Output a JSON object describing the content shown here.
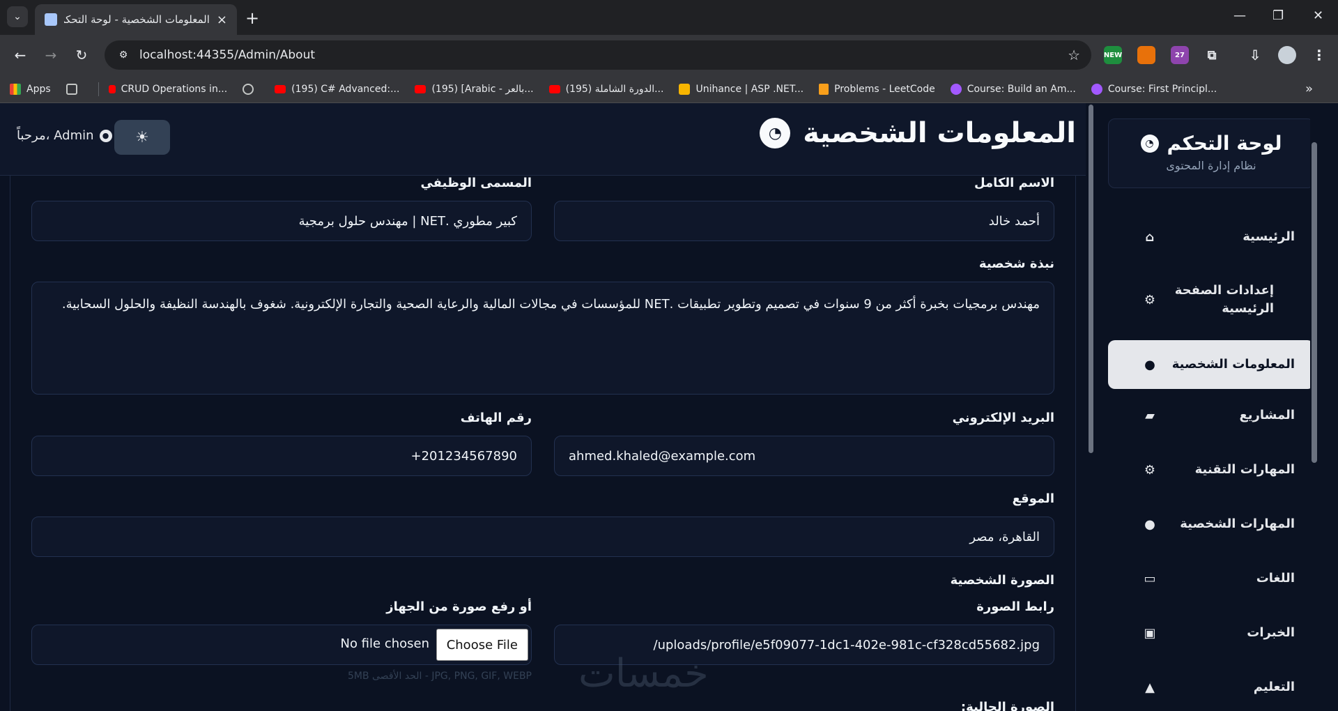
{
  "browser": {
    "tab_title": "المعلومات الشخصية - لوحة التحكم",
    "url": "localhost:44355/Admin/About",
    "ext_new_badge": "NEW",
    "ext_count_badge": "27",
    "bookmarks": [
      {
        "label": "Apps",
        "icon": "apps-icon"
      },
      {
        "label": "CRUD Operations in...",
        "icon": "red-icon"
      },
      {
        "label": "(195) C# Advanced:...",
        "icon": "youtube-icon"
      },
      {
        "label": "(195) [Arabic - بالعر...",
        "icon": "youtube-icon"
      },
      {
        "label": "(195) الدورة الشاملة...",
        "icon": "youtube-icon"
      },
      {
        "label": "Unihance | ASP .NET...",
        "icon": "unihance-icon"
      },
      {
        "label": "Problems - LeetCode",
        "icon": "leetcode-icon"
      },
      {
        "label": "Course: Build an Am...",
        "icon": "udemy-icon"
      },
      {
        "label": "Course: First Principl...",
        "icon": "udemy-icon"
      }
    ]
  },
  "sidebar": {
    "brand_title": "لوحة التحكم",
    "brand_subtitle": "نظام إدارة المحتوى",
    "items": [
      {
        "label": "الرئيسية",
        "icon": "⌂"
      },
      {
        "label": "إعدادات الصفحة الرئيسية",
        "icon": "⚙"
      },
      {
        "label": "المعلومات الشخصية",
        "icon": "●"
      },
      {
        "label": "المشاريع",
        "icon": "▰"
      },
      {
        "label": "المهارات التقنية",
        "icon": "⚙"
      },
      {
        "label": "المهارات الشخصية",
        "icon": "●"
      },
      {
        "label": "اللغات",
        "icon": "▭"
      },
      {
        "label": "الخبرات",
        "icon": "▣"
      },
      {
        "label": "التعليم",
        "icon": "▲"
      }
    ]
  },
  "header": {
    "page_title": "المعلومات الشخصية",
    "welcome": "مرحباً، Admin"
  },
  "form": {
    "full_name_label": "الاسم الكامل",
    "full_name_value": "أحمد خالد",
    "job_title_label": "المسمى الوظيفي",
    "job_title_value": "كبير مطوري .NET | مهندس حلول برمجية",
    "bio_label": "نبذة شخصية",
    "bio_value": "مهندس برمجيات بخبرة أكثر من 9 سنوات في تصميم وتطوير تطبيقات .NET للمؤسسات في مجالات المالية والرعاية الصحية والتجارة الإلكترونية. شغوف بالهندسة النظيفة والحلول السحابية.",
    "email_label": "البريد الإلكتروني",
    "email_value": "ahmed.khaled@example.com",
    "phone_label": "رقم الهاتف",
    "phone_value": "+201234567890",
    "location_label": "الموقع",
    "location_value": "القاهرة، مصر",
    "photo_section_label": "الصورة الشخصية",
    "image_url_label": "رابط الصورة",
    "image_url_value": "/uploads/profile/e5f09077-1dc1-402e-981c-cf328cd55682.jpg",
    "upload_label": "أو رفع صورة من الجهاز",
    "choose_file": "Choose File",
    "no_file": "No file chosen",
    "upload_hint": "JPG, PNG, GIF, WEBP - الحد الأقصى 5MB",
    "current_photo_label": "الصورة الحالية:"
  },
  "watermark": "خمسات"
}
